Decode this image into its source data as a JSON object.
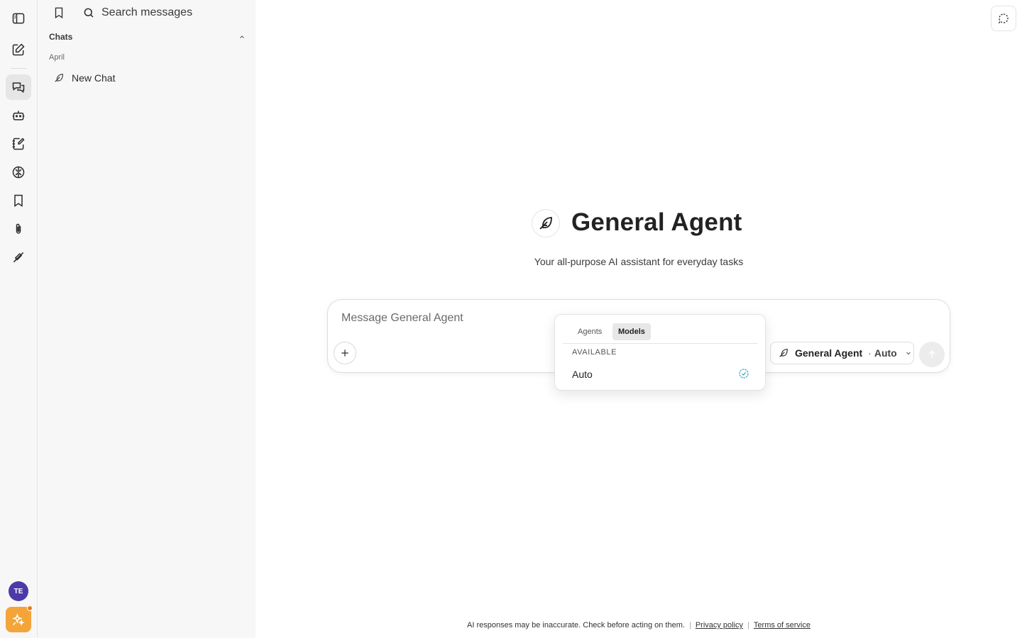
{
  "sidebar": {
    "search_placeholder": "Search messages",
    "section_title": "Chats",
    "group_label": "April",
    "chats": [
      {
        "label": "New Chat"
      }
    ]
  },
  "rail": {
    "avatar_initials": "TE"
  },
  "agent": {
    "name": "General Agent",
    "description": "Your all-purpose AI assistant for everyday tasks"
  },
  "composer": {
    "placeholder": "Message General Agent",
    "selector_agent": "General Agent",
    "selector_separator": "·",
    "selector_model": "Auto"
  },
  "popover": {
    "tab_agents": "Agents",
    "tab_models": "Models",
    "section": "AVAILABLE",
    "options": [
      {
        "label": "Auto",
        "selected": true
      }
    ]
  },
  "footer": {
    "disclaimer": "AI responses may be inaccurate. Check before acting on them.",
    "privacy": "Privacy policy",
    "terms": "Terms of service"
  },
  "colors": {
    "accent_check": "#3aa9bf",
    "avatar_bg": "#4d3aa8",
    "sparkle_bg": "#f3a53a"
  }
}
